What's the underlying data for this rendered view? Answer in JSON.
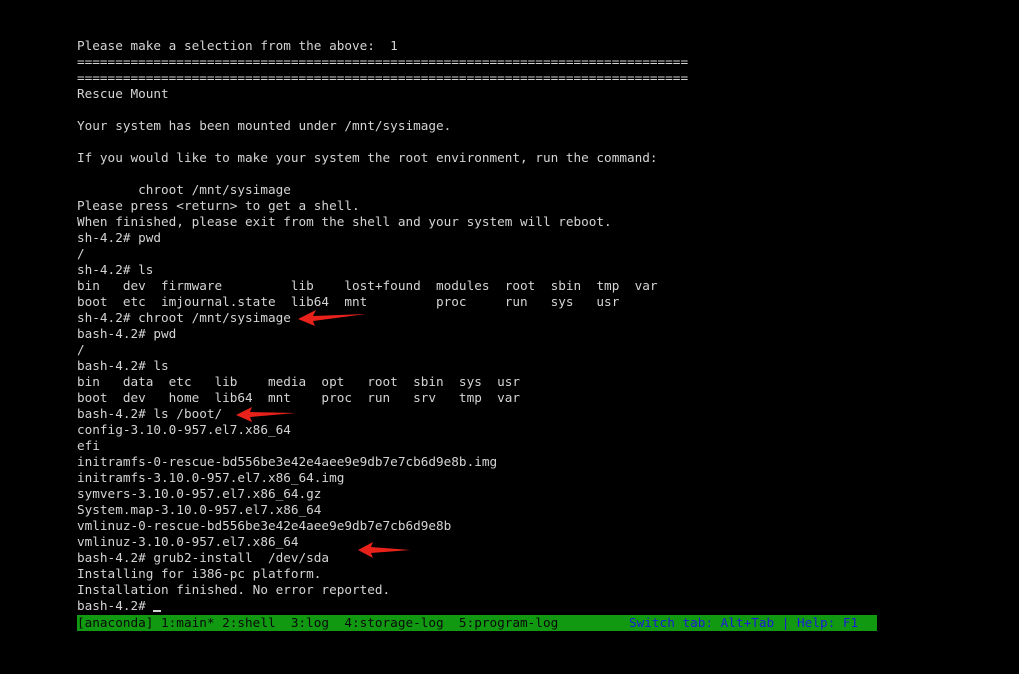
{
  "terminal": {
    "lines": [
      "Please make a selection from the above:  1",
      "================================================================================",
      "================================================================================",
      "Rescue Mount",
      "",
      "Your system has been mounted under /mnt/sysimage.",
      "",
      "If you would like to make your system the root environment, run the command:",
      "",
      "        chroot /mnt/sysimage",
      "Please press <return> to get a shell.",
      "When finished, please exit from the shell and your system will reboot.",
      "sh-4.2# pwd",
      "/",
      "sh-4.2# ls",
      "bin   dev  firmware         lib    lost+found  modules  root  sbin  tmp  var",
      "boot  etc  imjournal.state  lib64  mnt         proc     run   sys   usr",
      "sh-4.2# chroot /mnt/sysimage",
      "bash-4.2# pwd",
      "/",
      "bash-4.2# ls",
      "bin   data  etc   lib    media  opt   root  sbin  sys  usr",
      "boot  dev   home  lib64  mnt    proc  run   srv   tmp  var",
      "bash-4.2# ls /boot/",
      "config-3.10.0-957.el7.x86_64",
      "efi",
      "initramfs-0-rescue-bd556be3e42e4aee9e9db7e7cb6d9e8b.img",
      "initramfs-3.10.0-957.el7.x86_64.img",
      "symvers-3.10.0-957.el7.x86_64.gz",
      "System.map-3.10.0-957.el7.x86_64",
      "vmlinuz-0-rescue-bd556be3e42e4aee9e9db7e7cb6d9e8b",
      "vmlinuz-3.10.0-957.el7.x86_64",
      "bash-4.2# grub2-install  /dev/sda",
      "Installing for i386-pc platform.",
      "Installation finished. No error reported."
    ],
    "prompt": "bash-4.2# "
  },
  "statusbar": {
    "tabs": "[anaconda] 1:main* 2:shell  3:log  4:storage-log  5:program-log",
    "hint": "Switch tab: Alt+Tab | Help: F1"
  },
  "colors": {
    "background": "#000000",
    "text": "#d4d4d4",
    "status_bg": "#119a11",
    "status_hint": "#1c1cd8",
    "annotation_arrow": "#e8221b"
  }
}
